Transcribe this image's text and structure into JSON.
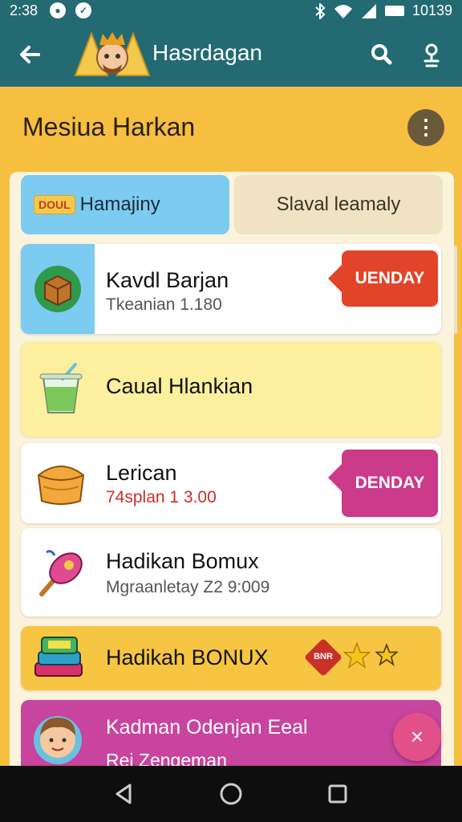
{
  "status_bar": {
    "time": "2:38",
    "right_text": "10139",
    "icons": [
      "notification-icon",
      "notification-icon",
      "bluetooth-icon",
      "wifi-icon",
      "signal-icon",
      "battery-icon"
    ]
  },
  "app_bar": {
    "title": "Hasrdagan",
    "icons": [
      "back-arrow-icon",
      "logo-icon",
      "search-icon",
      "account-icon"
    ]
  },
  "header": {
    "title": "Mesiua Harkan",
    "more_icon": "more-vertical-icon"
  },
  "tabs": [
    {
      "badge": "DOUL",
      "label": "Hamajiny"
    },
    {
      "label": "Slaval leamaly"
    }
  ],
  "cards": [
    {
      "title": "Kavdl Barjan",
      "subtitle": "Tkeanian 1.180",
      "tag": "UENDAY",
      "tag_color": "#e2442a",
      "icon": "box-icon"
    },
    {
      "title": "Caual Hlankian",
      "icon": "drink-cup-icon"
    },
    {
      "title": "Lerican",
      "subtitle": "74splan 1 3.00",
      "tag": "DENDAY",
      "tag_color": "#cc3a8a",
      "icon": "basket-icon"
    },
    {
      "title": "Hadikan Bomux",
      "subtitle": "Mgraanletay Z2 9:009",
      "icon": "ice-cream-icon"
    },
    {
      "title": "Hadikah BONUX",
      "badge": "BNR",
      "icon": "books-icon"
    },
    {
      "title": "Kadman Odenjan Eeal",
      "subtitle": "Rei Zengeman",
      "icon": "avatar-icon"
    }
  ],
  "colors": {
    "primary": "#236a73",
    "background": "#f6bf3f",
    "panel": "#fbf3dc",
    "fab": "#e2508a"
  },
  "fab": {
    "icon": "close-icon",
    "label": "×"
  },
  "nav": {
    "icons": [
      "nav-back-icon",
      "nav-home-icon",
      "nav-recents-icon"
    ]
  }
}
